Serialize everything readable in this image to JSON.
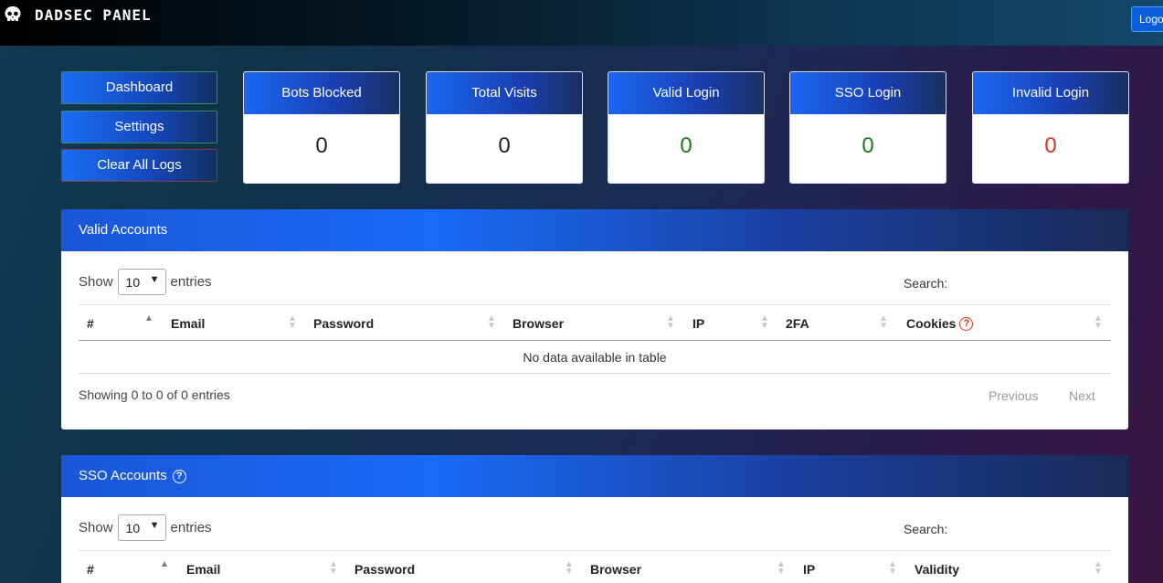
{
  "header": {
    "brand": "DADSEC PANEL",
    "logout_label": "Logout"
  },
  "sidebar": {
    "dashboard": "Dashboard",
    "settings": "Settings",
    "clear_logs": "Clear All Logs"
  },
  "stats": [
    {
      "label": "Bots Blocked",
      "value": "0"
    },
    {
      "label": "Total Visits",
      "value": "0"
    },
    {
      "label": "Valid Login",
      "value": "0"
    },
    {
      "label": "SSO Login",
      "value": "0"
    },
    {
      "label": "Invalid Login",
      "value": "0"
    }
  ],
  "valid_accounts": {
    "title": "Valid Accounts",
    "show": "Show",
    "entries_value": "10",
    "entries": "entries",
    "search": "Search:",
    "columns": [
      "#",
      "Email",
      "Password",
      "Browser",
      "IP",
      "2FA",
      "Cookies"
    ],
    "empty": "No data available in table",
    "info": "Showing 0 to 0 of 0 entries",
    "previous": "Previous",
    "next": "Next"
  },
  "sso_accounts": {
    "title": "SSO Accounts",
    "show": "Show",
    "entries_value": "10",
    "entries": "entries",
    "search": "Search:",
    "columns": [
      "#",
      "Email",
      "Password",
      "Browser",
      "IP",
      "Validity"
    ]
  },
  "icons": {
    "brand": "skull-icon",
    "help": "question-circle-icon",
    "select": "chevron-down-icon"
  },
  "colors": {
    "accent": "#1a66f2",
    "success": "#1e7a1e",
    "danger": "#d03a1a"
  }
}
